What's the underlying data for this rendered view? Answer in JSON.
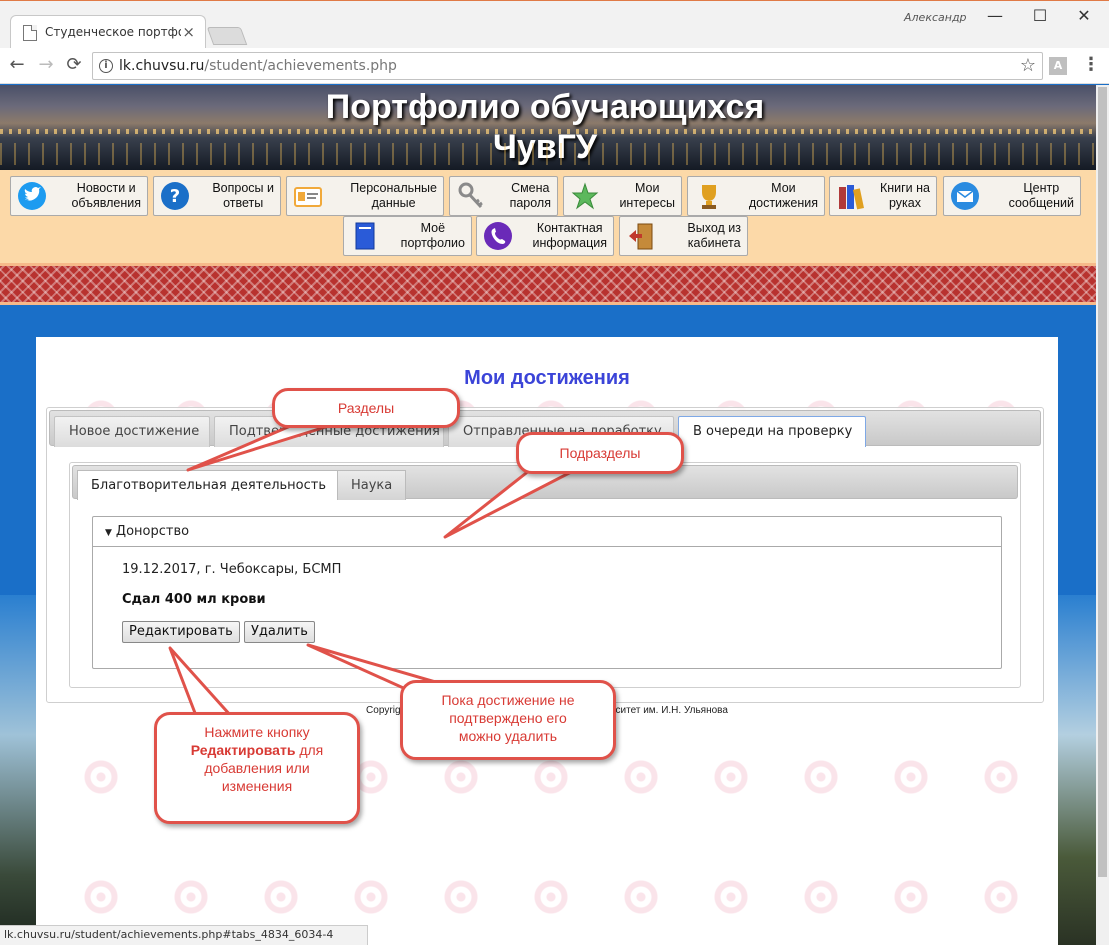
{
  "browser": {
    "tab_title": "Студенческое портфолио",
    "tab_close": "×",
    "user_name": "Александр",
    "win_min": "—",
    "win_max": "☐",
    "win_close": "✕",
    "url_host": "lk.chuvsu.ru",
    "url_path": "/student/achievements.php",
    "status_url": "lk.chuvsu.ru/student/achievements.php#tabs_4834_6034-4",
    "back_glyph": "←",
    "forward_glyph": "→",
    "reload_glyph": "⟳",
    "star_glyph": "☆",
    "menu_glyph": "⋮",
    "info_glyph": "i",
    "ext_glyph": "A"
  },
  "site": {
    "title_line1": "Портфолио обучающихся",
    "title_line2": "ЧувГУ"
  },
  "menu": {
    "row1": [
      {
        "label1": "Новости и",
        "label2": "объявления",
        "icon": "twitter-bird-icon",
        "color": "#1d9bf0"
      },
      {
        "label1": "Вопросы и",
        "label2": "ответы",
        "icon": "question-icon",
        "color": "#1a6fc8"
      },
      {
        "label1": "Персональные",
        "label2": "данные",
        "icon": "id-card-icon",
        "color": "#f1a93a"
      },
      {
        "label1": "Смена",
        "label2": "пароля",
        "icon": "keys-icon",
        "color": "#8a8a8a"
      },
      {
        "label1": "Мои",
        "label2": "интересы",
        "icon": "star-icon",
        "color": "#5cb85c"
      },
      {
        "label1": "Мои",
        "label2": "достижения",
        "icon": "trophy-icon",
        "color": "#e0a020"
      },
      {
        "label1": "Книги на",
        "label2": "руках",
        "icon": "books-icon",
        "color": "#b03a3a"
      },
      {
        "label1": "Центр",
        "label2": "сообщений",
        "icon": "envelope-icon",
        "color": "#2a8be0"
      }
    ],
    "row2": [
      {
        "label1": "Моё",
        "label2": "портфолио",
        "icon": "portfolio-book-icon",
        "color": "#2a5bd8"
      },
      {
        "label1": "Контактная",
        "label2": "информация",
        "icon": "phone-icon",
        "color": "#6a2ab8"
      },
      {
        "label1": "Выход из",
        "label2": "кабинета",
        "icon": "exit-door-icon",
        "color": "#c0392b"
      }
    ]
  },
  "page": {
    "heading": "Мои достижения",
    "tabs": [
      "Новое достижение",
      "Подтверждённые достижения",
      "Отправленные на доработку",
      "В очереди на проверку"
    ],
    "subtabs": [
      "Благотворительная деятельность",
      "Наука"
    ],
    "section": "Донорство",
    "achievement_place": "19.12.2017, г. Чебоксары, БСМП",
    "achievement_title": "Сдал 400 мл крови",
    "edit_label": "Редактировать",
    "delete_label": "Удалить",
    "copyright": "Copyright © 2017 Чувашский государственный университет им. И.Н. Ульянова"
  },
  "callouts": {
    "sections": "Разделы",
    "subsections": "Подразделы",
    "delete_note_1": "Пока достижение не",
    "delete_note_2": "подтверждено его",
    "delete_note_3": "можно удалить",
    "edit_note_1": "Нажмите кнопку",
    "edit_note_bold": "Редактировать",
    "edit_note_2": " для",
    "edit_note_3": "добавления или",
    "edit_note_4": "изменения"
  },
  "colors": {
    "accent": "#3b44d8",
    "callout": "#e0524a",
    "page_bg": "#1a6fc8",
    "menu_bg": "#fcd9a8"
  }
}
